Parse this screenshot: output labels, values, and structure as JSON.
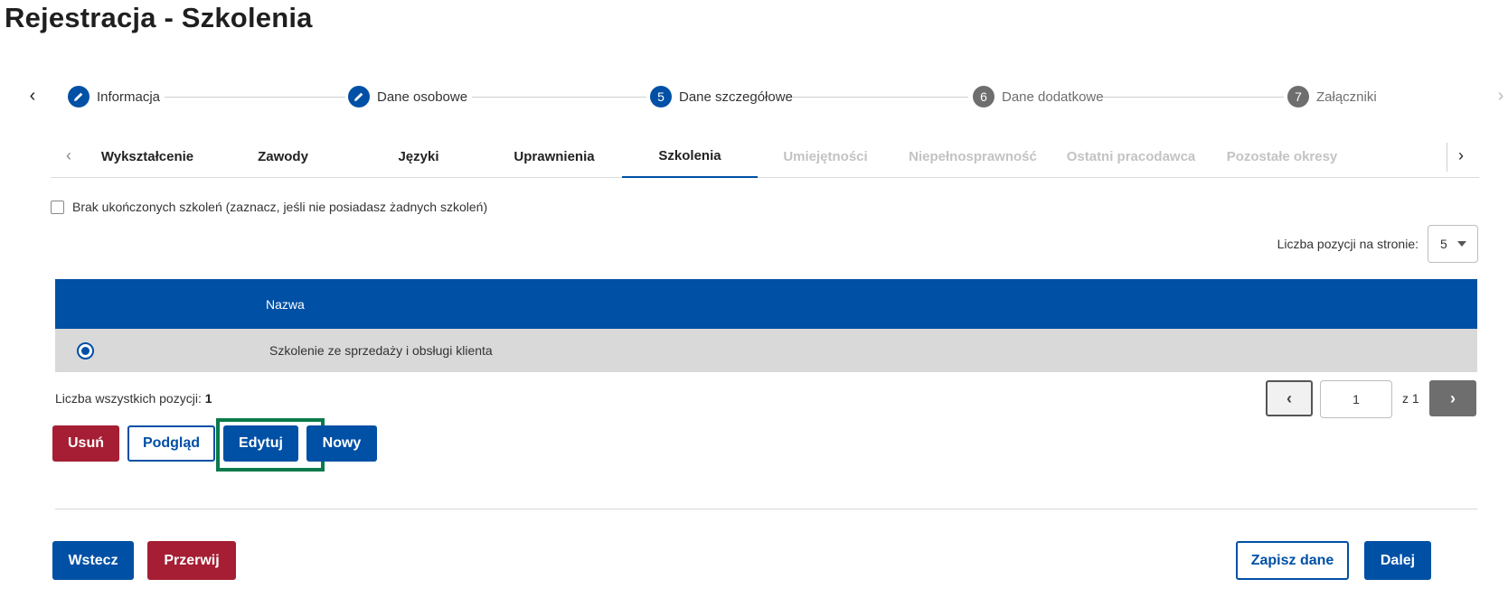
{
  "page": {
    "title": "Rejestracja - Szkolenia"
  },
  "stepper": {
    "steps": [
      {
        "label": "Informacja",
        "number": "",
        "state": "completed"
      },
      {
        "label": "Dane osobowe",
        "number": "",
        "state": "completed"
      },
      {
        "label": "Dane szczegółowe",
        "number": "5",
        "state": "current"
      },
      {
        "label": "Dane dodatkowe",
        "number": "6",
        "state": "upcoming"
      },
      {
        "label": "Załączniki",
        "number": "7",
        "state": "upcoming"
      }
    ]
  },
  "tabs": {
    "items": [
      {
        "label": "Wykształcenie",
        "enabled": true
      },
      {
        "label": "Zawody",
        "enabled": true
      },
      {
        "label": "Języki",
        "enabled": true
      },
      {
        "label": "Uprawnienia",
        "enabled": true
      },
      {
        "label": "Szkolenia",
        "enabled": true,
        "active": true
      },
      {
        "label": "Umiejętności",
        "enabled": false
      },
      {
        "label": "Niepełnosprawność",
        "enabled": false
      },
      {
        "label": "Ostatni pracodawca",
        "enabled": false
      },
      {
        "label": "Pozostałe okresy",
        "enabled": false
      }
    ]
  },
  "no_training": {
    "label": "Brak ukończonych szkoleń (zaznacz, jeśli nie posiadasz żadnych szkoleń)",
    "checked": false
  },
  "page_size": {
    "label": "Liczba pozycji na stronie:",
    "value": "5"
  },
  "table": {
    "columns": [
      "Nazwa"
    ],
    "rows": [
      {
        "name": "Szkolenie ze sprzedaży i obsługi klienta",
        "selected": true
      }
    ]
  },
  "summary": {
    "label": "Liczba wszystkich pozycji:",
    "count": "1"
  },
  "pagination": {
    "current": "1",
    "of_label": "z 1"
  },
  "actions": {
    "delete": "Usuń",
    "preview": "Podgląd",
    "edit": "Edytuj",
    "new": "Nowy"
  },
  "footer": {
    "back": "Wstecz",
    "abort": "Przerwij",
    "save": "Zapisz dane",
    "next": "Dalej"
  },
  "colors": {
    "primary": "#0050a5",
    "danger": "#a51e33",
    "focus": "#0a7a4b",
    "row_selected": "#d9d9d9"
  }
}
